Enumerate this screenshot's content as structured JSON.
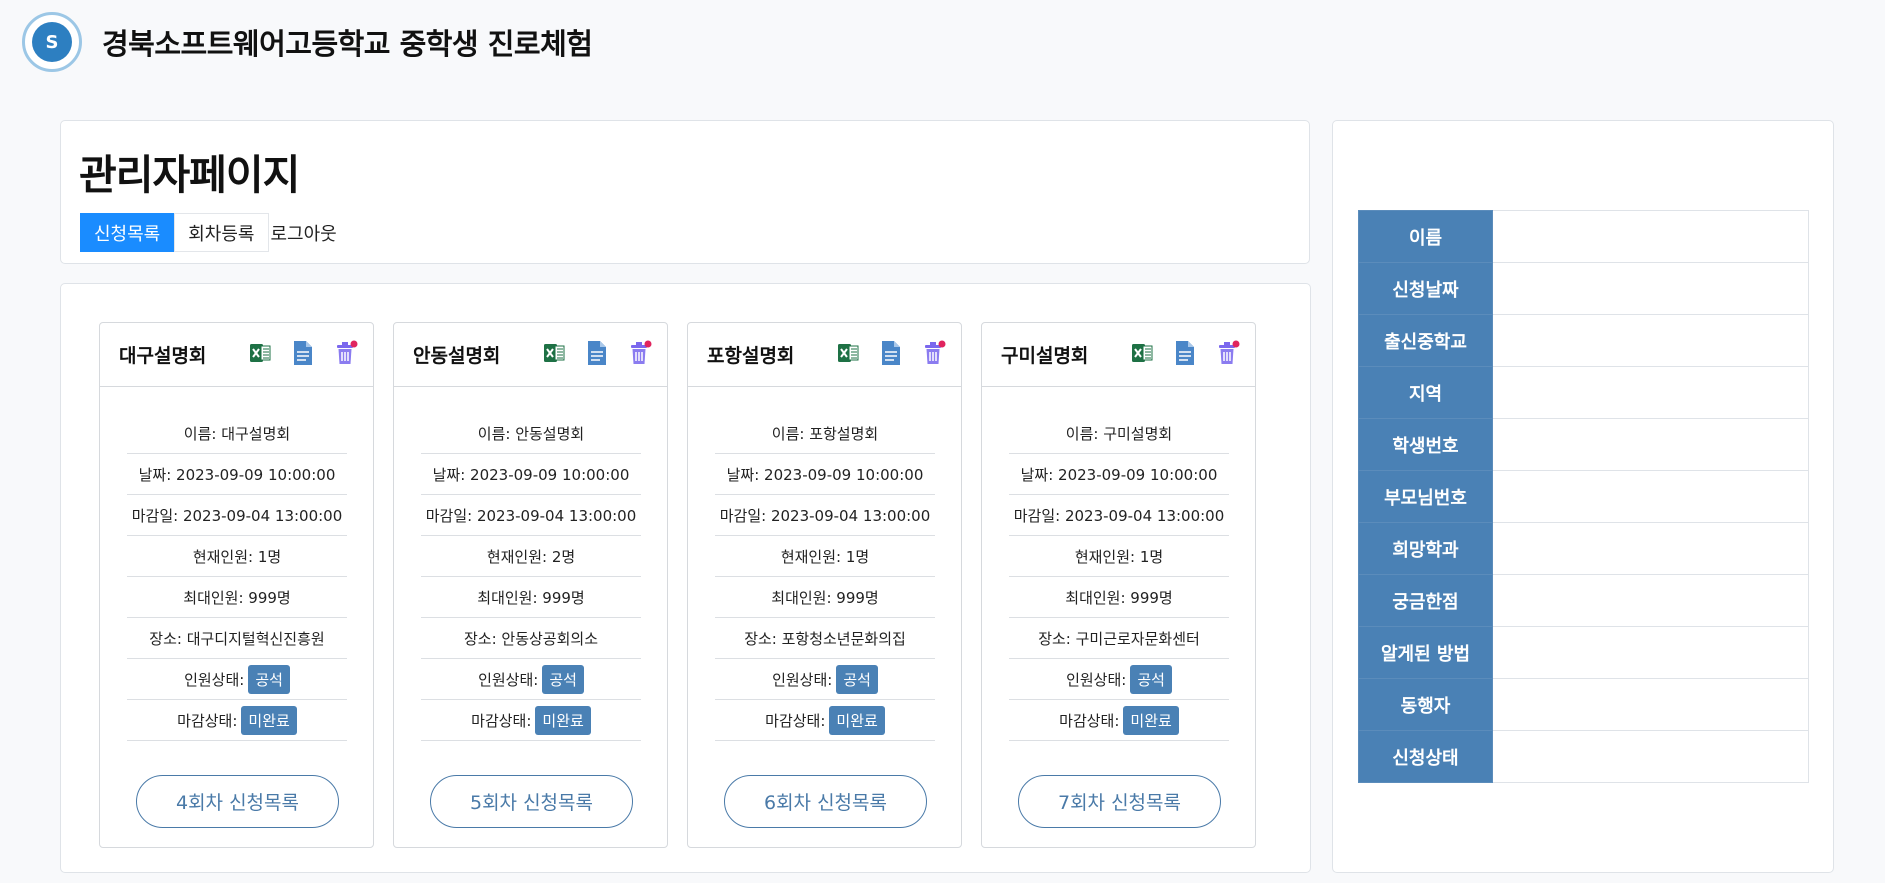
{
  "site": {
    "title": "경북소프트웨어고등학교 중학생 진로체험",
    "logo_text": "S"
  },
  "admin": {
    "title": "관리자페이지",
    "nav": [
      {
        "label": "신청목록",
        "active": true
      },
      {
        "label": "회차등록",
        "active": false
      },
      {
        "label": "로그아웃",
        "active": false
      }
    ]
  },
  "icons": {
    "excel": "excel-icon",
    "document": "document-icon",
    "delete": "trash-icon"
  },
  "colors": {
    "accent": "#1a8cff",
    "badge": "#4a81b5",
    "button": "#4a7aa8"
  },
  "sessions": [
    {
      "title": "대구설명회",
      "rows": [
        "이름: 대구설명회",
        "날짜: 2023-09-09 10:00:00",
        "마감일: 2023-09-04 13:00:00",
        "현재인원: 1명",
        "최대인원: 999명",
        "장소: 대구디지털혁신진흥원"
      ],
      "capacity_label": "인원상태:",
      "capacity_badge": "공석",
      "deadline_label": "마감상태:",
      "deadline_badge": "미완료",
      "button": "4회차 신청목록"
    },
    {
      "title": "안동설명회",
      "rows": [
        "이름: 안동설명회",
        "날짜: 2023-09-09 10:00:00",
        "마감일: 2023-09-04 13:00:00",
        "현재인원: 2명",
        "최대인원: 999명",
        "장소: 안동상공회의소"
      ],
      "capacity_label": "인원상태:",
      "capacity_badge": "공석",
      "deadline_label": "마감상태:",
      "deadline_badge": "미완료",
      "button": "5회차 신청목록"
    },
    {
      "title": "포항설명회",
      "rows": [
        "이름: 포항설명회",
        "날짜: 2023-09-09 10:00:00",
        "마감일: 2023-09-04 13:00:00",
        "현재인원: 1명",
        "최대인원: 999명",
        "장소: 포항청소년문화의집"
      ],
      "capacity_label": "인원상태:",
      "capacity_badge": "공석",
      "deadline_label": "마감상태:",
      "deadline_badge": "미완료",
      "button": "6회차 신청목록"
    },
    {
      "title": "구미설명회",
      "rows": [
        "이름: 구미설명회",
        "날짜: 2023-09-09 10:00:00",
        "마감일: 2023-09-04 13:00:00",
        "현재인원: 1명",
        "최대인원: 999명",
        "장소: 구미근로자문화센터"
      ],
      "capacity_label": "인원상태:",
      "capacity_badge": "공석",
      "deadline_label": "마감상태:",
      "deadline_badge": "미완료",
      "button": "7회차 신청목록"
    }
  ],
  "detail": {
    "fields": [
      "이름",
      "신청날짜",
      "출신중학교",
      "지역",
      "학생번호",
      "부모님번호",
      "희망학과",
      "궁금한점",
      "알게된 방법",
      "동행자",
      "신청상태"
    ],
    "values": [
      "",
      "",
      "",
      "",
      "",
      "",
      "",
      "",
      "",
      "",
      ""
    ]
  }
}
